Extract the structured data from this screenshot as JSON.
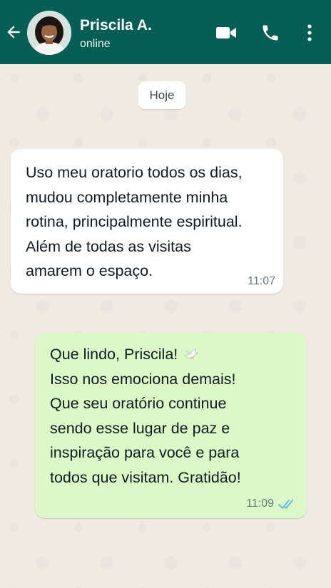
{
  "header": {
    "contact_name": "Priscila A.",
    "status": "online",
    "icons": [
      "back-arrow-icon",
      "video-call-icon",
      "phone-call-icon",
      "more-options-icon"
    ]
  },
  "chat": {
    "date_label": "Hoje",
    "messages": [
      {
        "direction": "incoming",
        "text": "Uso meu oratorio todos os dias,\nmudou completamente minha\nrotina, principalmente espiritual.\nAlém de todas as visitas\namarem o espaço.",
        "time": "11:07"
      },
      {
        "direction": "outgoing",
        "text_line1": "Que lindo, Priscila!",
        "emoji": "dove-emoji",
        "text_rest": "Isso nos emociona demais!\nQue seu oratório continue\nsendo esse lugar de paz e\ninspiração para você e para\ntodos que visitam. Gratidão!",
        "time": "11:09",
        "read_status": "read"
      }
    ]
  },
  "colors": {
    "header_bg": "#075e54",
    "chat_bg": "#efeae2",
    "incoming_bubble": "#ffffff",
    "outgoing_bubble": "#dcf8c6",
    "read_ticks": "#53bdeb"
  }
}
